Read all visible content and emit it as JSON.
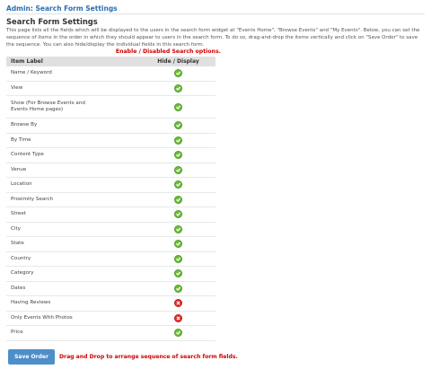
{
  "page_title": "Admin: Search Form Settings",
  "section_title": "Search Form Settings",
  "description": "This page lists all the fields which will be displayed to the users in the search form widget at \"Events Home\", \"Browse Events\" and \"My Events\". Below, you can set the sequence of items in the order in which they should appear to users in the search form. To do so, drag-and-drop the items vertically and click on \"Save Order\" to save the sequence. You can also hide/display the individual fields in this search form.",
  "enable_note": "Enable / Disabled Search options.",
  "table": {
    "headers": [
      "Item Label",
      "Hide / Display"
    ],
    "rows": [
      {
        "label": "Name / Keyword",
        "status": "enabled"
      },
      {
        "label": "View",
        "status": "enabled"
      },
      {
        "label": "Show (For Browse Events and Events Home pages)",
        "status": "enabled"
      },
      {
        "label": "Browse By",
        "status": "enabled"
      },
      {
        "label": "By Time",
        "status": "enabled"
      },
      {
        "label": "Content Type",
        "status": "enabled"
      },
      {
        "label": "Venue",
        "status": "enabled"
      },
      {
        "label": "Location",
        "status": "enabled"
      },
      {
        "label": "Proximity Search",
        "status": "enabled"
      },
      {
        "label": "Street",
        "status": "enabled"
      },
      {
        "label": "City",
        "status": "enabled"
      },
      {
        "label": "State",
        "status": "enabled"
      },
      {
        "label": "Country",
        "status": "enabled"
      },
      {
        "label": "Category",
        "status": "enabled"
      },
      {
        "label": "Dates",
        "status": "enabled"
      },
      {
        "label": "Having Reviews",
        "status": "disabled"
      },
      {
        "label": "Only Events With Photos",
        "status": "disabled"
      },
      {
        "label": "Price",
        "status": "enabled"
      }
    ]
  },
  "icons": {
    "enabled": "check-circle-icon",
    "disabled": "x-circle-icon"
  },
  "colors": {
    "title_blue": "#2a6fb2",
    "note_red": "#d00000",
    "enabled_green": "#6cbf3a",
    "disabled_red": "#e0302a",
    "button_blue": "#4d8fc8",
    "header_gray": "#e0e0e0"
  },
  "save_button_label": "Save Order",
  "drag_note": "Drag and Drop to arrange sequence of search form fields."
}
